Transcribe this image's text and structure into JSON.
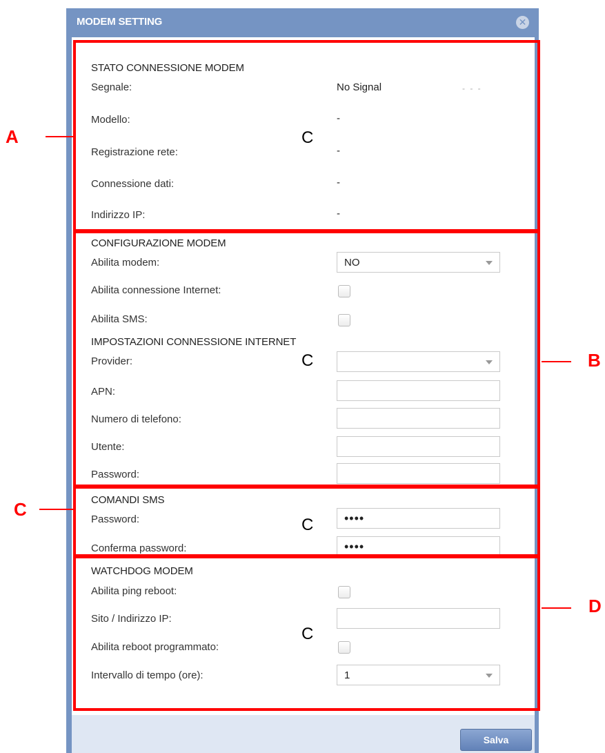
{
  "dialog": {
    "title": "MODEM SETTING",
    "close_icon": "close-circle-icon",
    "save_label": "Salva",
    "accent_color": "#7594c3"
  },
  "stato": {
    "heading": "STATO CONNESSIONE MODEM",
    "rows": [
      {
        "label": "Segnale:",
        "value": "No Signal",
        "extra": "- - -"
      },
      {
        "label": "Modello:",
        "value": "-"
      },
      {
        "label": "Registrazione rete:",
        "value": "-"
      },
      {
        "label": "Connessione dati:",
        "value": "-"
      },
      {
        "label": "Indirizzo IP:",
        "value": "-"
      }
    ]
  },
  "configurazione": {
    "heading": "CONFIGURAZIONE MODEM",
    "abilita_modem": {
      "label": "Abilita modem:",
      "value": "NO"
    },
    "abilita_internet": {
      "label": "Abilita connessione Internet:",
      "checked": false
    },
    "abilita_sms": {
      "label": "Abilita SMS:",
      "checked": false
    }
  },
  "internet": {
    "heading": "IMPOSTAZIONI CONNESSIONE INTERNET",
    "provider": {
      "label": "Provider:",
      "value": ""
    },
    "apn": {
      "label": "APN:",
      "value": ""
    },
    "numero": {
      "label": "Numero di telefono:",
      "value": ""
    },
    "utente": {
      "label": "Utente:",
      "value": ""
    },
    "password": {
      "label": "Password:",
      "value": ""
    }
  },
  "sms": {
    "heading": "COMANDI SMS",
    "password": {
      "label": "Password:",
      "value": "••••"
    },
    "conferma": {
      "label": "Conferma password:",
      "value": "••••"
    }
  },
  "watchdog": {
    "heading": "WATCHDOG MODEM",
    "ping_reboot": {
      "label": "Abilita ping reboot:",
      "checked": false
    },
    "sito": {
      "label": "Sito / Indirizzo IP:",
      "value": ""
    },
    "reboot_programmato": {
      "label": "Abilita reboot programmato:",
      "checked": false
    },
    "intervallo": {
      "label": "Intervallo di tempo (ore):",
      "value": "1"
    }
  },
  "annotations": {
    "letters": {
      "a": "A",
      "b": "B",
      "c": "C",
      "d": "D"
    },
    "region_marks": [
      "C",
      "C",
      "C",
      "C"
    ],
    "color": "#ff0000"
  }
}
